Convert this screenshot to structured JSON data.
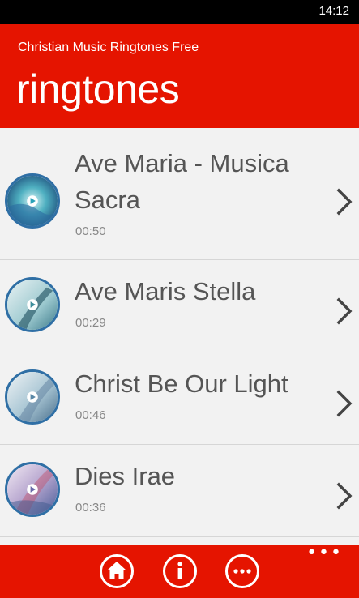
{
  "status_bar": {
    "time": "14:12"
  },
  "header": {
    "app_title": "Christian Music Ringtones Free",
    "page_title": "ringtones"
  },
  "ringtones": [
    {
      "title_line1": "Ave Maria - Musica",
      "title_line2": "Sacra",
      "duration": "00:50"
    },
    {
      "title_line1": "Ave Maris Stella",
      "title_line2": "",
      "duration": "00:29"
    },
    {
      "title_line1": "Christ Be Our Light",
      "title_line2": "",
      "duration": "00:46"
    },
    {
      "title_line1": "Dies Irae",
      "title_line2": "",
      "duration": "00:36"
    }
  ],
  "app_bar": {
    "buttons": [
      "home-icon",
      "info-icon",
      "more-icon"
    ],
    "more_dots": "•••"
  },
  "colors": {
    "accent": "#e51400",
    "ring": "#2f6fa5",
    "text": "#555555",
    "subtext": "#888888"
  }
}
